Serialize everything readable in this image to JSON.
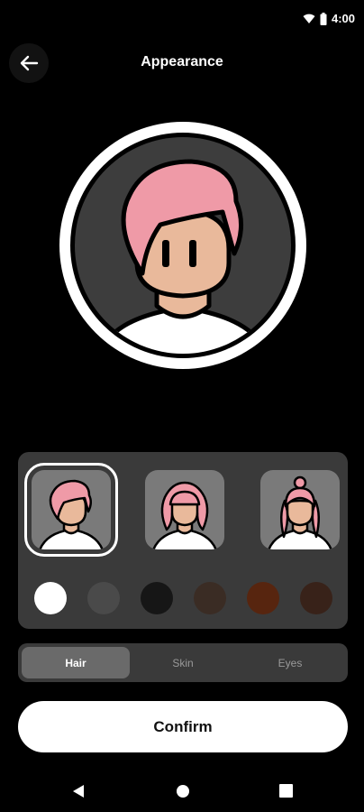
{
  "status_bar": {
    "time": "4:00"
  },
  "header": {
    "title": "Appearance"
  },
  "avatar": {
    "hair_color": "#ef9aa7",
    "skin_color": "#e9b99b",
    "background": "#3d3d3d"
  },
  "hair_styles": {
    "selected_index": 0
  },
  "colors": {
    "swatches": [
      "#ffffff",
      "#4a4a4a",
      "#161616",
      "#3a2c24",
      "#57250f",
      "#382219"
    ],
    "selected_index": 0
  },
  "tabs": [
    {
      "label": "Hair",
      "active": true
    },
    {
      "label": "Skin",
      "active": false
    },
    {
      "label": "Eyes",
      "active": false
    }
  ],
  "actions": {
    "confirm_label": "Confirm"
  }
}
